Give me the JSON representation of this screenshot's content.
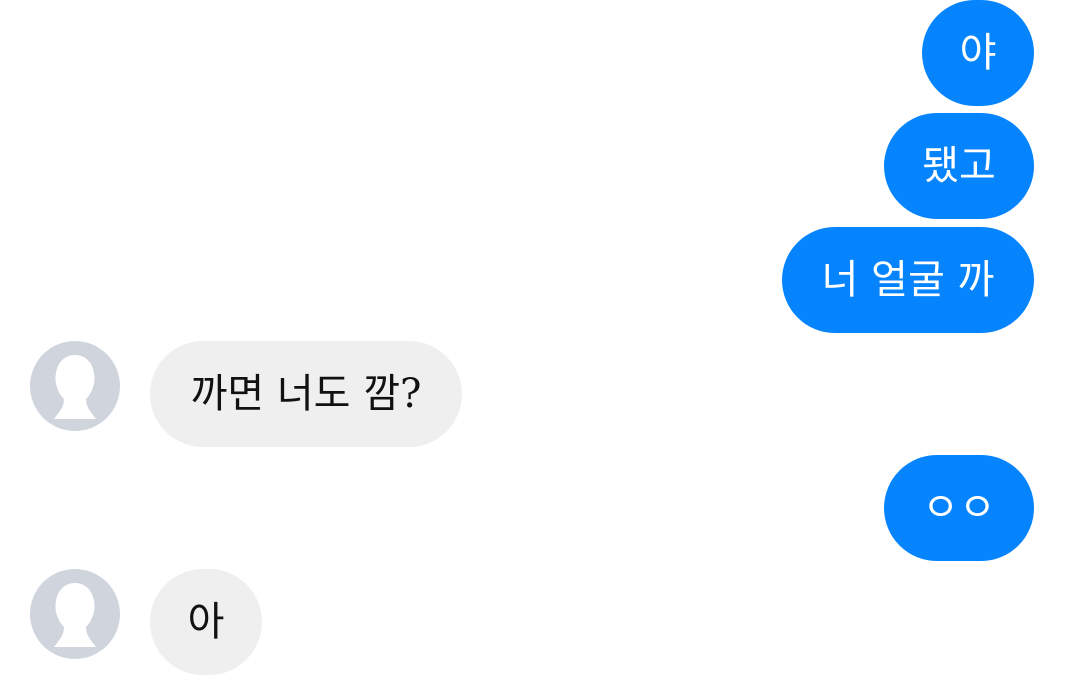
{
  "conversation": {
    "messages": [
      {
        "direction": "sent",
        "text": "야"
      },
      {
        "direction": "sent",
        "text": "됐고"
      },
      {
        "direction": "sent",
        "text": "너 얼굴 까"
      },
      {
        "direction": "received",
        "text": "까면 너도 깜?"
      },
      {
        "direction": "sent",
        "text": "ㅇㅇ"
      },
      {
        "direction": "received",
        "text": "아"
      }
    ]
  },
  "colors": {
    "sent_bubble": "#0584fe",
    "received_bubble": "#efefef",
    "avatar_placeholder": "#d0d5dd",
    "background": "#ffffff"
  },
  "icons": {
    "avatar": "default-profile-silhouette-icon"
  }
}
